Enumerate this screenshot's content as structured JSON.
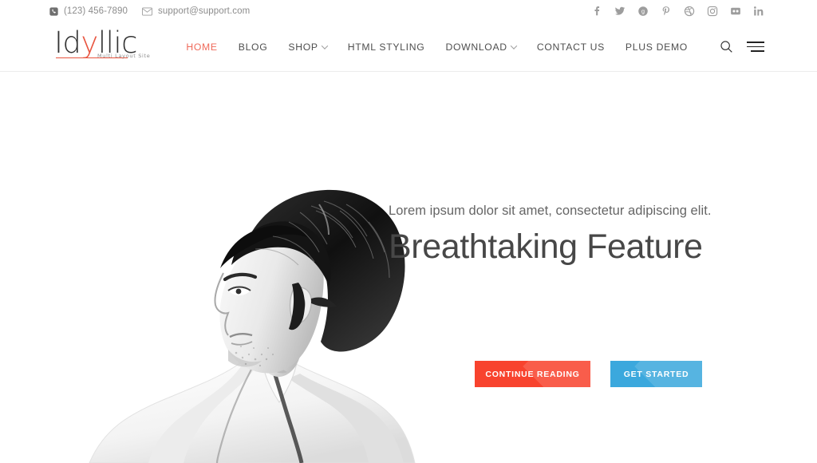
{
  "topbar": {
    "phone": {
      "icon": "phone-icon",
      "text": "(123) 456-7890"
    },
    "email": {
      "icon": "mail-icon",
      "text": "support@support.com"
    },
    "social": [
      {
        "name": "facebook-icon",
        "label": "f"
      },
      {
        "name": "twitter-icon",
        "label": "t"
      },
      {
        "name": "google-plus-icon",
        "label": "g+"
      },
      {
        "name": "pinterest-icon",
        "label": "p"
      },
      {
        "name": "dribbble-icon",
        "label": "d"
      },
      {
        "name": "instagram-icon",
        "label": "ig"
      },
      {
        "name": "flickr-icon",
        "label": "fl"
      },
      {
        "name": "linkedin-icon",
        "label": "in"
      }
    ]
  },
  "header": {
    "logo": {
      "part1": "Id",
      "accent": "y",
      "part2": "llic",
      "full": "Idyllic",
      "tagline": "Multi Layout Site"
    },
    "nav": [
      {
        "label": "HOME",
        "active": true,
        "caret": false
      },
      {
        "label": "BLOG",
        "active": false,
        "caret": false
      },
      {
        "label": "SHOP",
        "active": false,
        "caret": true
      },
      {
        "label": "HTML STYLING",
        "active": false,
        "caret": false
      },
      {
        "label": "DOWNLOAD",
        "active": false,
        "caret": true
      },
      {
        "label": "CONTACT US",
        "active": false,
        "caret": false
      },
      {
        "label": "PLUS DEMO",
        "active": false,
        "caret": false
      }
    ],
    "tools": {
      "search": "search-icon",
      "menu": "hamburger-menu-icon"
    }
  },
  "hero": {
    "subtitle": "Lorem ipsum dolor sit amet, consectetur adipiscing elit.",
    "title": "Breathtaking Feature",
    "image_alt": "Black and white portrait photo of a young man",
    "buttons": [
      {
        "label": "CONTINUE READING",
        "style": "primary"
      },
      {
        "label": "GET STARTED",
        "style": "secondary"
      }
    ]
  },
  "colors": {
    "accent_red": "#f8432e",
    "accent_blue": "#3ba8dd",
    "logo_accent": "#e8543f",
    "nav_active": "#ef6a5a",
    "text_dark": "#474747",
    "text_muted": "#8c8c8c"
  }
}
